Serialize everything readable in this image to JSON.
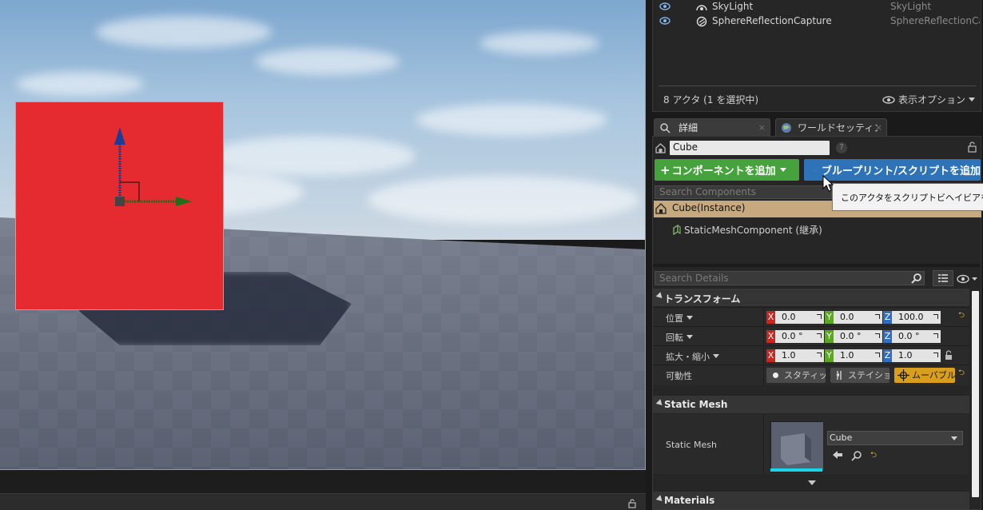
{
  "outliner": {
    "rows": [
      {
        "name": "SkyLight",
        "type": "SkyLight"
      },
      {
        "name": "SphereReflectionCapture",
        "type": "SphereReflectionCapture"
      }
    ],
    "actor_count": "8 アクタ (1 を選択中)",
    "view_options": "表示オプション"
  },
  "tabs": {
    "details": "詳細",
    "world_settings": "ワールドセッティング",
    "close_glyph": "×"
  },
  "details": {
    "actor_name": "Cube",
    "help_glyph": "?",
    "add_component": "コンポーネントを追加",
    "add_component_plus": "+",
    "blueprint_button": "ブループリント/スクリプトを追加",
    "search_components_placeholder": "Search Components",
    "tooltip": "このアクタをスクリプトビヘイビアを追加",
    "component_instance": "Cube(Instance)",
    "component_mesh": "StaticMeshComponent (継承)",
    "search_details_placeholder": "Search Details"
  },
  "transform": {
    "header": "トランスフォーム",
    "location": {
      "label": "位置",
      "x": "0.0",
      "y": "0.0",
      "z": "100.0"
    },
    "rotation": {
      "label": "回転",
      "x": "0.0 °",
      "y": "0.0 °",
      "z": "0.0 °"
    },
    "scale": {
      "label": "拡大・縮小",
      "x": "1.0",
      "y": "1.0",
      "z": "1.0"
    },
    "mobility": {
      "label": "可動性",
      "static": "スタティック",
      "stationary": "ステイショナリー",
      "movable": "ムーバブル",
      "selected": "movable"
    },
    "axis_x": "X",
    "axis_y": "Y",
    "axis_z": "Z"
  },
  "static_mesh": {
    "header": "Static Mesh",
    "label": "Static Mesh",
    "value": "Cube"
  },
  "materials": {
    "header": "Materials"
  },
  "colors": {
    "cube": "#e52b30",
    "add_button": "#46a23d",
    "blueprint_button": "#2e73b8",
    "selected_mobility": "#d89e1c",
    "selected_component": "#c6a97f"
  }
}
